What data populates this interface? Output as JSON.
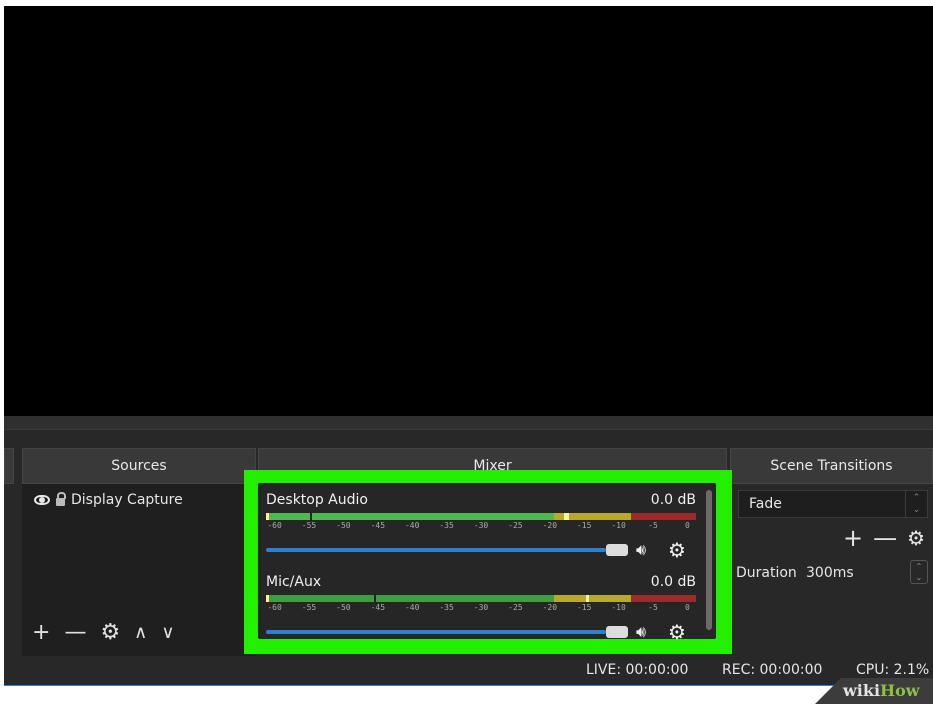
{
  "docks": {
    "sources_title": "Sources",
    "mixer_title": "Mixer",
    "transitions_title": "Scene Transitions"
  },
  "sources": {
    "items": [
      {
        "label": "Display Capture",
        "visible_icon": "eye-icon",
        "lock_icon": "lock-icon"
      }
    ],
    "toolbar": [
      "+",
      "—",
      "⚙",
      "∧",
      "∨"
    ]
  },
  "mixer": {
    "tracks": [
      {
        "name": "Desktop Audio",
        "db": "0.0 dB",
        "volume": 1.0
      },
      {
        "name": "Mic/Aux",
        "db": "0.0 dB",
        "volume": 1.0
      }
    ],
    "scale": [
      "-60",
      "-55",
      "-50",
      "-45",
      "-40",
      "-35",
      "-30",
      "-25",
      "-20",
      "-15",
      "-10",
      "-5",
      "0"
    ],
    "highlight_color": "#22f000",
    "slider_color": "#2e7fd0"
  },
  "transitions": {
    "selected": "Fade",
    "duration_label": "Duration",
    "duration_value": "300ms"
  },
  "status": {
    "live": "LIVE: 00:00:00",
    "rec": "REC: 00:00:00",
    "cpu": "CPU: 2.1%"
  },
  "watermark": {
    "part1": "wiki",
    "part2": "How"
  }
}
